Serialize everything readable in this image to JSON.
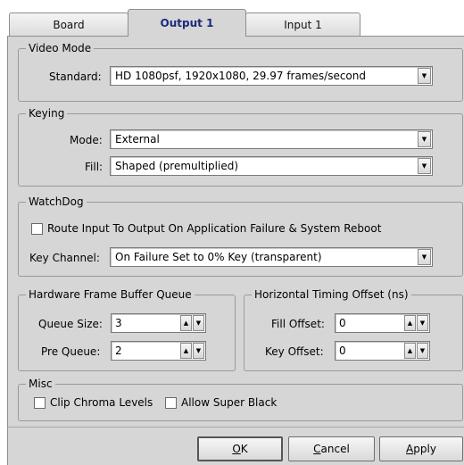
{
  "tabs": [
    {
      "label": "Board"
    },
    {
      "label": "Output 1"
    },
    {
      "label": "Input 1"
    }
  ],
  "video_mode": {
    "title": "Video Mode",
    "standard_label": "Standard:",
    "standard_value": "HD 1080psf, 1920x1080, 29.97 frames/second"
  },
  "keying": {
    "title": "Keying",
    "mode_label": "Mode:",
    "mode_value": "External",
    "fill_label": "Fill:",
    "fill_value": "Shaped (premultiplied)"
  },
  "watchdog": {
    "title": "WatchDog",
    "route_label": "Route Input To Output On Application Failure & System Reboot",
    "key_channel_label": "Key Channel:",
    "key_channel_value": "On Failure Set to 0% Key (transparent)"
  },
  "hw_queue": {
    "title": "Hardware Frame Buffer Queue",
    "queue_size_label": "Queue Size:",
    "queue_size_value": "3",
    "pre_queue_label": "Pre Queue:",
    "pre_queue_value": "2"
  },
  "timing": {
    "title": "Horizontal Timing Offset (ns)",
    "fill_offset_label": "Fill Offset:",
    "fill_offset_value": "0",
    "key_offset_label": "Key Offset:",
    "key_offset_value": "0"
  },
  "misc": {
    "title": "Misc",
    "clip_label": "Clip Chroma Levels",
    "super_black_label": "Allow Super Black"
  },
  "buttons": {
    "ok_accel": "O",
    "ok_rest": "K",
    "cancel_accel": "C",
    "cancel_rest": "ancel",
    "apply_accel": "A",
    "apply_rest": "pply"
  }
}
